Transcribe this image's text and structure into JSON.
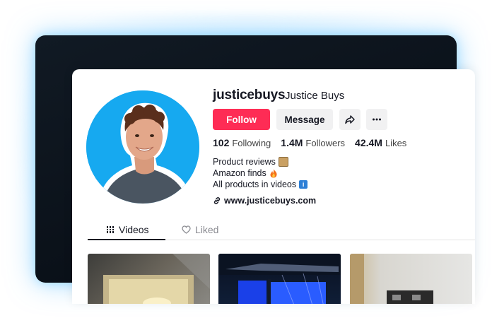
{
  "profile": {
    "username": "justicebuys",
    "display_name": "Justice Buys",
    "follow_label": "Follow",
    "message_label": "Message",
    "stats": [
      {
        "value": "102",
        "label": "Following"
      },
      {
        "value": "1.4M",
        "label": "Followers"
      },
      {
        "value": "42.4M",
        "label": "Likes"
      }
    ],
    "bio": [
      {
        "text": "Product reviews",
        "emoji": "package-emoji"
      },
      {
        "text": "Amazon finds",
        "emoji": "fire-emoji"
      },
      {
        "text": "All products in videos",
        "emoji": "info-emoji"
      }
    ],
    "website": "www.justicebuys.com"
  },
  "tabs": [
    {
      "label": "Videos",
      "icon": "grid-icon",
      "active": true
    },
    {
      "label": "Liked",
      "icon": "liked-heart-icon",
      "active": false
    }
  ],
  "colors": {
    "follow": "#fe2c55",
    "avatar_bg": "#16a9f0",
    "glow": "#7cc8ff",
    "dark_card": "#0a1119"
  }
}
